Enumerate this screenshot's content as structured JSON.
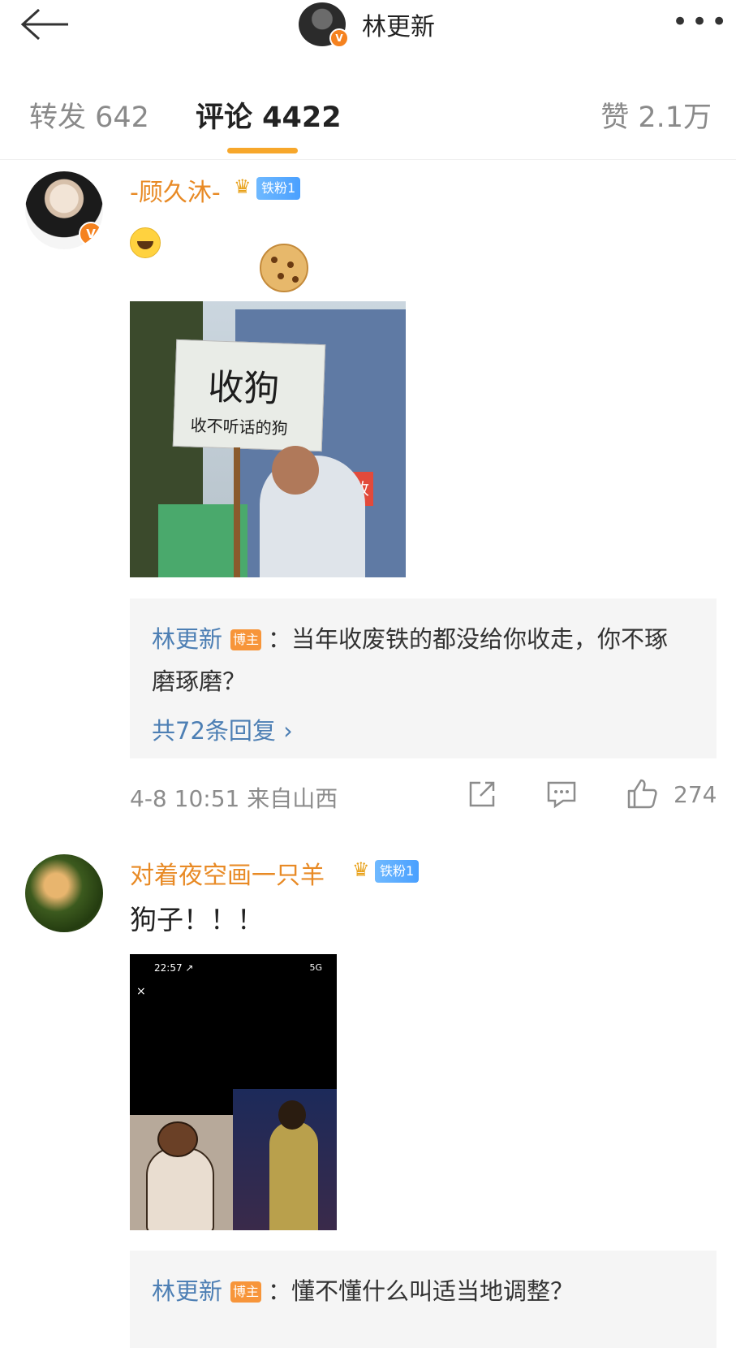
{
  "header": {
    "title": "林更新",
    "back_label": "←",
    "more_label": "•••"
  },
  "tabs": [
    {
      "label": "转发 642"
    },
    {
      "label": "评论 4422",
      "active": true
    },
    {
      "label": "赞 2.1万"
    }
  ],
  "colors": {
    "accent": "#f7a72b",
    "username": "#e88a25",
    "link": "#4d7fb4",
    "verified": "#f5821f",
    "fan_badge": "#4aa0ff"
  },
  "comments": [
    {
      "username": "-顾久沐-",
      "fan_badge": "铁粉1",
      "emoji": "laughing-emoji",
      "image": {
        "sign_text": "收狗",
        "sign_subtext": "收不听话的狗",
        "red_sign_text": "品回收"
      },
      "reply": {
        "author": "林更新",
        "badge": "博主",
        "text": "：当年收废铁的都没给你收走，你不琢磨琢磨？",
        "more": "共72条回复 ›"
      },
      "meta": "4-8 10:51  来自山西",
      "like_count": "274"
    },
    {
      "username": "对着夜空画一只羊",
      "fan_badge": "铁粉1",
      "text": "狗子！！！",
      "image": {
        "status_time": "22:57 ↗",
        "status_right": "5G",
        "close_label": "×"
      },
      "reply": {
        "author": "林更新",
        "badge": "博主",
        "text": "：懂不懂什么叫适当地调整？"
      }
    }
  ]
}
